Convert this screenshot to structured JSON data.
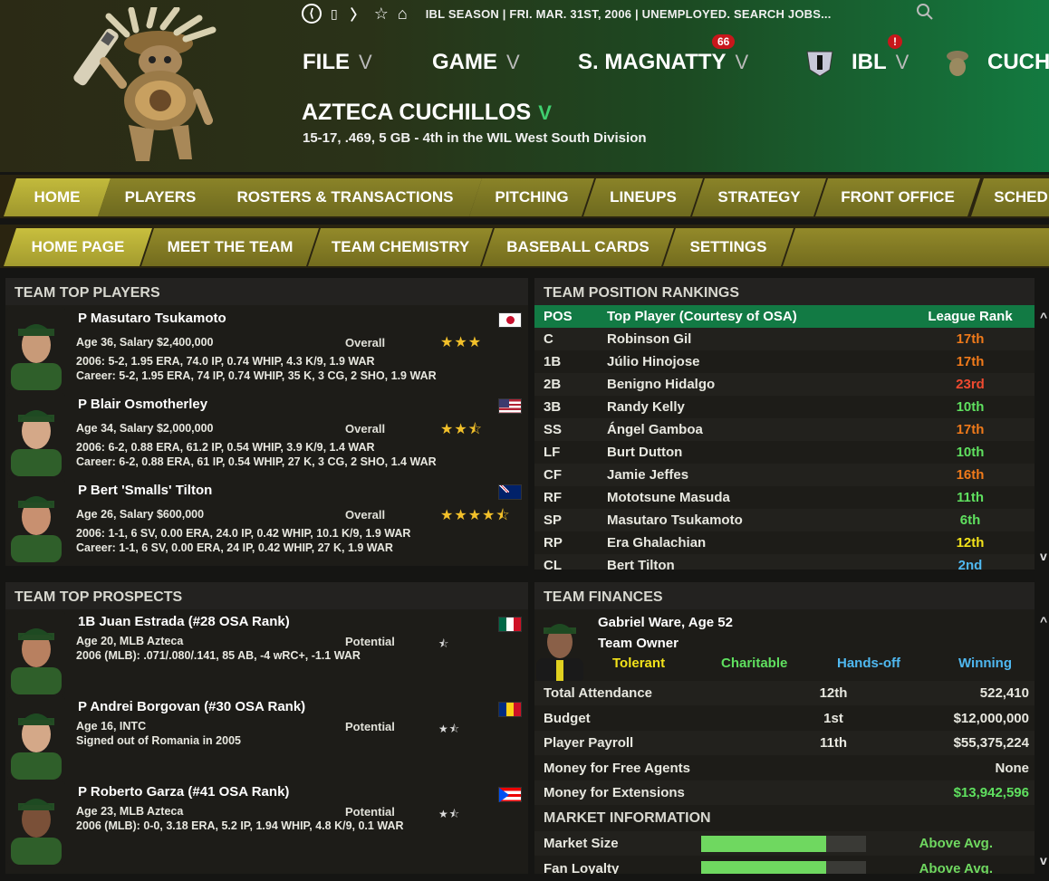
{
  "topbar": {
    "season": "IBL SEASON  |  FRI. MAR. 31ST, 2006  |  UNEMPLOYED. SEARCH JOBS...",
    "search_icon": "search-icon"
  },
  "menus": {
    "file": "FILE",
    "game": "GAME",
    "manager": "S. MAGNATTY",
    "manager_badge": "66",
    "league": "IBL",
    "league_badge": "!",
    "team_short": "CUCH"
  },
  "team": {
    "name": "AZTECA CUCHILLOS",
    "record": "15-17, .469, 5 GB - 4th in the WIL West South Division"
  },
  "tabs": [
    "HOME",
    "PLAYERS",
    "ROSTERS & TRANSACTIONS",
    "PITCHING",
    "LINEUPS",
    "STRATEGY",
    "FRONT OFFICE",
    "SCHED"
  ],
  "subtabs": [
    "HOME PAGE",
    "MEET THE TEAM",
    "TEAM CHEMISTRY",
    "BASEBALL CARDS",
    "SETTINGS"
  ],
  "top_players": {
    "title": "TEAM TOP PLAYERS",
    "overall_label": "Overall",
    "players": [
      {
        "name": "P Masutaro Tsukamoto",
        "age_salary": "Age 36, Salary $2,400,000",
        "season": "2006: 5-2, 1.95 ERA, 74.0 IP, 0.74 WHIP, 4.3 K/9, 1.9 WAR",
        "career": "Career: 5-2, 1.95 ERA, 74 IP, 0.74 WHIP, 35 K, 3 CG, 2 SHO, 1.9 WAR",
        "stars": "★★★",
        "flag": "japan"
      },
      {
        "name": "P Blair Osmotherley",
        "age_salary": "Age 34, Salary $2,000,000",
        "season": "2006: 6-2, 0.88 ERA, 61.2 IP, 0.54 WHIP, 3.9 K/9, 1.4 WAR",
        "career": "Career: 6-2, 0.88 ERA, 61 IP, 0.54 WHIP, 27 K, 3 CG, 2 SHO, 1.4 WAR",
        "stars": "★★⯪",
        "flag": "usa"
      },
      {
        "name": "P Bert 'Smalls' Tilton",
        "age_salary": "Age 26, Salary $600,000",
        "season": "2006: 1-1, 6 SV, 0.00 ERA, 24.0 IP, 0.42 WHIP, 10.1 K/9, 1.9 WAR",
        "career": "Career: 1-1, 6 SV, 0.00 ERA, 24 IP, 0.42 WHIP, 27 K, 1.9 WAR",
        "stars": "★★★★⯪",
        "flag": "australia"
      }
    ]
  },
  "prospects": {
    "title": "TEAM TOP PROSPECTS",
    "potential_label": "Potential",
    "players": [
      {
        "name": "1B Juan Estrada (#28 OSA Rank)",
        "line1": "Age 20, MLB Azteca",
        "line2": "2006 (MLB): .071/.080/.141, 85 AB, -4 wRC+, -1.1 WAR",
        "stars": "⯪",
        "flag": "mexico"
      },
      {
        "name": "P Andrei Borgovan (#30 OSA Rank)",
        "line1": "Age 16, INTC",
        "line2": "Signed out of Romania in 2005",
        "stars": "★⯪",
        "flag": "romania"
      },
      {
        "name": "P Roberto Garza (#41 OSA Rank)",
        "line1": "Age 23, MLB Azteca",
        "line2": "2006 (MLB): 0-0, 3.18 ERA, 5.2 IP, 1.94 WHIP, 4.8 K/9, 0.1 WAR",
        "stars": "★⯪",
        "flag": "puertorico"
      }
    ]
  },
  "rankings": {
    "title": "TEAM POSITION RANKINGS",
    "headers": [
      "POS",
      "Top Player (Courtesy of OSA)",
      "League Rank"
    ],
    "rows": [
      {
        "pos": "C",
        "player": "Robinson Gil",
        "rank": "17th",
        "color": "#f07a1a"
      },
      {
        "pos": "1B",
        "player": "Júlio Hinojose",
        "rank": "17th",
        "color": "#f07a1a"
      },
      {
        "pos": "2B",
        "player": "Benigno Hidalgo",
        "rank": "23rd",
        "color": "#f04a30"
      },
      {
        "pos": "3B",
        "player": "Randy Kelly",
        "rank": "10th",
        "color": "#5fe05f"
      },
      {
        "pos": "SS",
        "player": "Ángel Gamboa",
        "rank": "17th",
        "color": "#f07a1a"
      },
      {
        "pos": "LF",
        "player": "Burt Dutton",
        "rank": "10th",
        "color": "#5fe05f"
      },
      {
        "pos": "CF",
        "player": "Jamie Jeffes",
        "rank": "16th",
        "color": "#f07a1a"
      },
      {
        "pos": "RF",
        "player": "Mototsune Masuda",
        "rank": "11th",
        "color": "#5fe05f"
      },
      {
        "pos": "SP",
        "player": "Masutaro Tsukamoto",
        "rank": "6th",
        "color": "#5fe05f"
      },
      {
        "pos": "RP",
        "player": "Era Ghalachian",
        "rank": "12th",
        "color": "#f2e21a"
      },
      {
        "pos": "CL",
        "player": "Bert Tilton",
        "rank": "2nd",
        "color": "#4fb8f0"
      }
    ]
  },
  "finances": {
    "title": "TEAM FINANCES",
    "owner_name": "Gabriel Ware, Age 52",
    "owner_role": "Team Owner",
    "traits": [
      {
        "label": "Tolerant",
        "color": "#f2e21a"
      },
      {
        "label": "Charitable",
        "color": "#5fe05f"
      },
      {
        "label": "Hands-off",
        "color": "#4fb8f0"
      },
      {
        "label": "Winning",
        "color": "#4fb8f0"
      }
    ],
    "rows": [
      {
        "label": "Total Attendance",
        "rank": "12th",
        "value": "522,410",
        "color": "#e8e8e0"
      },
      {
        "label": "Budget",
        "rank": "1st",
        "value": "$12,000,000",
        "color": "#e8e8e0"
      },
      {
        "label": "Player Payroll",
        "rank": "11th",
        "value": "$55,375,224",
        "color": "#e8e8e0"
      },
      {
        "label": "Money for Free Agents",
        "rank": "",
        "value": "None",
        "color": "#e8e8e0"
      },
      {
        "label": "Money for Extensions",
        "rank": "",
        "value": "$13,942,596",
        "color": "#5fe05f"
      }
    ],
    "market_title": "MARKET INFORMATION",
    "market": [
      {
        "label": "Market Size",
        "level": 0.76,
        "value": "Above Avg."
      },
      {
        "label": "Fan Loyalty",
        "level": 0.76,
        "value": "Above Avg."
      }
    ]
  }
}
